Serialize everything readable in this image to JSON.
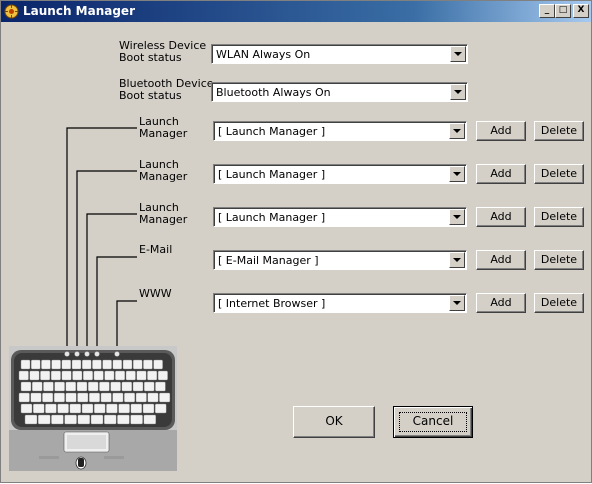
{
  "window": {
    "title": "Launch Manager",
    "minimize": "_",
    "maximize": "□",
    "close": "X"
  },
  "wireless": {
    "label": "Wireless Device\nBoot status",
    "line1": "Wireless Device",
    "line2": "Boot status",
    "value": "WLAN Always On"
  },
  "bluetooth": {
    "line1": "Bluetooth Device",
    "line2": "Boot status",
    "value": "Bluetooth Always On"
  },
  "rows": [
    {
      "line1": "Launch",
      "line2": "Manager",
      "value": "[  Launch Manager  ]",
      "add": "Add",
      "delete": "Delete"
    },
    {
      "line1": "Launch",
      "line2": "Manager",
      "value": "[  Launch Manager  ]",
      "add": "Add",
      "delete": "Delete"
    },
    {
      "line1": "Launch",
      "line2": "Manager",
      "value": "[  Launch Manager  ]",
      "add": "Add",
      "delete": "Delete"
    },
    {
      "line1": "E-Mail",
      "line2": "",
      "value": "[  E-Mail Manager  ]",
      "add": "Add",
      "delete": "Delete"
    },
    {
      "line1": "WWW",
      "line2": "",
      "value": "[  Internet Browser  ]",
      "add": "Add",
      "delete": "Delete"
    }
  ],
  "buttons": {
    "ok": "OK",
    "cancel": "Cancel"
  },
  "icons": {
    "title": "launch-manager-app-icon",
    "combo_arrow": "chevron-down-icon"
  },
  "colors": {
    "titlebar_start": "#0a246a",
    "titlebar_end": "#a6caf0",
    "dialog_face": "#d4d0c8"
  }
}
